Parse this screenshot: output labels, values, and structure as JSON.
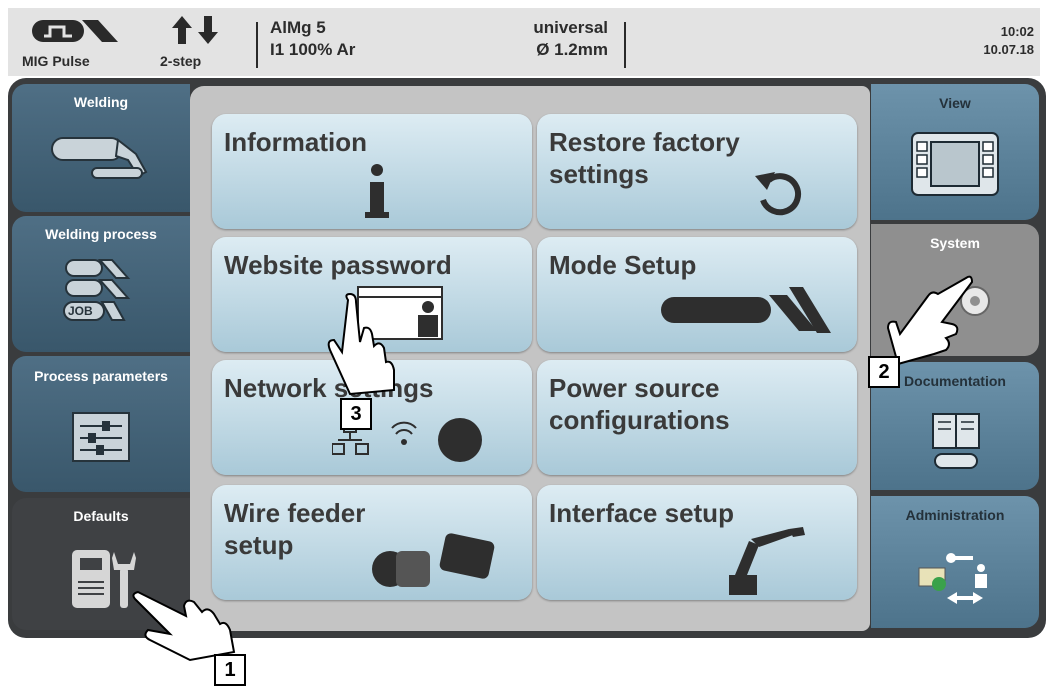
{
  "status": {
    "mode": "MIG Pulse",
    "trigger": "2-step",
    "material": "AlMg 5",
    "gas": "I1 100% Ar",
    "characteristic": "universal",
    "diameter": "Ø  1.2mm",
    "time": "10:02",
    "date": "10.07.18"
  },
  "left_tabs": [
    {
      "label": "Welding"
    },
    {
      "label": "Welding process"
    },
    {
      "label": "Process parameters"
    },
    {
      "label": "Defaults",
      "active": true
    }
  ],
  "right_tabs": [
    {
      "label": "View"
    },
    {
      "label": "System",
      "active": true
    },
    {
      "label": "Documentation"
    },
    {
      "label": "Administration"
    }
  ],
  "tiles": [
    {
      "label": "Information",
      "icon": "info-icon"
    },
    {
      "label": "Restore factory settings",
      "icon": "restore-icon"
    },
    {
      "label": "Website password",
      "icon": "website-password-icon"
    },
    {
      "label": "Mode Setup",
      "icon": "torch-icon"
    },
    {
      "label": "Network settings",
      "icon": "network-icon"
    },
    {
      "label": "Power source configurations",
      "icon": ""
    },
    {
      "label": "Wire feeder setup",
      "icon": "wire-feeder-icon"
    },
    {
      "label": "Interface setup",
      "icon": "robot-arm-icon"
    }
  ],
  "job_label": "JOB",
  "callouts": [
    "1",
    "2",
    "3"
  ],
  "colors": {
    "tab_blue": "#4f6f85",
    "tile_top": "#ddecf3",
    "tile_bottom": "#a9c9d8",
    "frame": "#3a3c3e"
  }
}
